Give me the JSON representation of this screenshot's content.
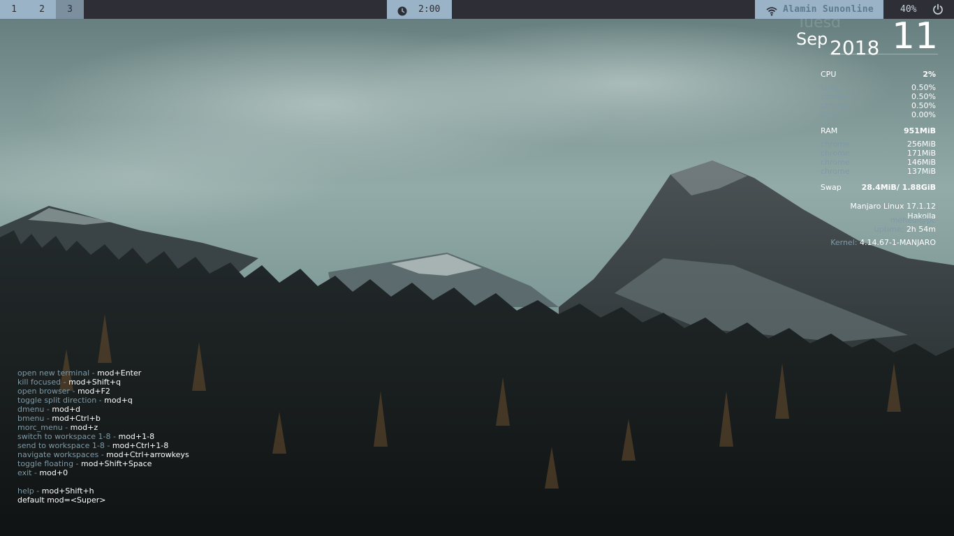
{
  "topbar": {
    "workspaces": [
      {
        "label": "1",
        "focused": false
      },
      {
        "label": "2",
        "focused": false
      },
      {
        "label": "3",
        "focused": true
      }
    ],
    "clock": {
      "icon": "clock-icon",
      "time": "2:00"
    },
    "network": {
      "icon": "wifi-icon",
      "ssid": "Alamin Sunonline"
    },
    "battery": {
      "label": "40%"
    },
    "power": {
      "icon": "power-icon"
    }
  },
  "conky": {
    "day_name": "Tuesd",
    "month": "Sep",
    "year": "2018",
    "day": "11",
    "cpu": {
      "label": "CPU",
      "total": "2%",
      "procs": [
        {
          "name": "conky",
          "value": "0.50%"
        },
        {
          "name": "compton",
          "value": "0.50%"
        },
        {
          "name": "chrome",
          "value": "0.50%"
        },
        {
          "name": "scrot",
          "value": "0.00%"
        }
      ]
    },
    "ram": {
      "label": "RAM",
      "total": "951MiB",
      "procs": [
        {
          "name": "chrome",
          "value": "256MiB"
        },
        {
          "name": "chrome",
          "value": "171MiB"
        },
        {
          "name": "chrome",
          "value": "146MiB"
        },
        {
          "name": "chrome",
          "value": "137MiB"
        }
      ]
    },
    "swap": {
      "label": "Swap",
      "value": "28.4MiB/ 1.88GiB"
    },
    "distro": "Manjaro Linux 17.1.12 Hakoila",
    "user": "mehedi@pc",
    "uptime_label": "uptime:",
    "uptime_value": "2h 54m",
    "kernel_label": "Kernel:",
    "kernel_value": "4.14.67-1-MANJARO"
  },
  "keybindings": {
    "items": [
      {
        "desc": "open new terminal",
        "key": "mod+Enter"
      },
      {
        "desc": "kill focused",
        "key": "mod+Shift+q"
      },
      {
        "desc": "open browser",
        "key": "mod+F2"
      },
      {
        "desc": "toggle split direction",
        "key": "mod+q"
      },
      {
        "desc": "dmenu",
        "key": "mod+d"
      },
      {
        "desc": "bmenu",
        "key": "mod+Ctrl+b"
      },
      {
        "desc": "morc_menu",
        "key": "mod+z"
      },
      {
        "desc": "switch to workspace 1-8",
        "key": "mod+1-8"
      },
      {
        "desc": "send to workspace 1-8",
        "key": "mod+Ctrl+1-8"
      },
      {
        "desc": "navigate workspaces",
        "key": "mod+Ctrl+arrowkeys"
      },
      {
        "desc": "toggle floating",
        "key": "mod+Shift+Space"
      },
      {
        "desc": "exit",
        "key": "mod+0"
      }
    ],
    "help": {
      "desc": "help",
      "key": "mod+Shift+h"
    },
    "default_mod": "default mod=<Super>"
  },
  "colors": {
    "bar_bg": "#2d2e36",
    "accent": "#9ab3c7",
    "accent_focused": "#7b8f9e",
    "dim_text": "#7f9aa6"
  }
}
